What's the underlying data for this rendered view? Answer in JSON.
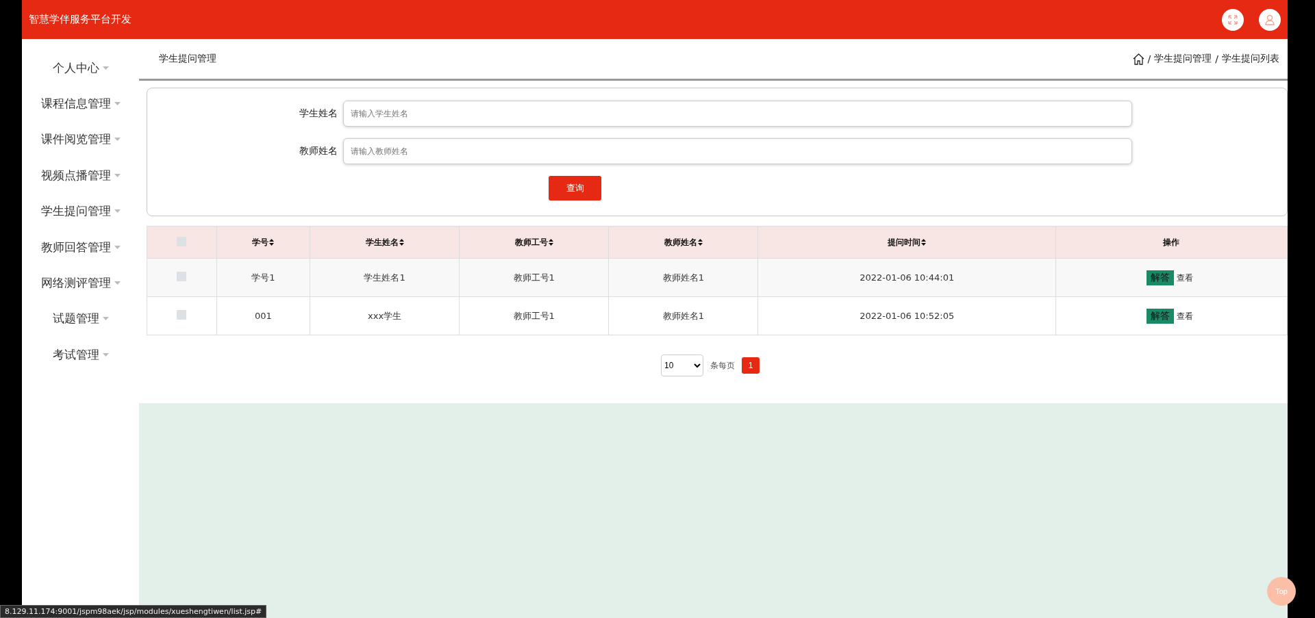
{
  "header": {
    "title": "智慧学伴服务平台开发"
  },
  "sidebar": {
    "items": [
      {
        "label": "个人中心"
      },
      {
        "label": "课程信息管理"
      },
      {
        "label": "课件阅览管理"
      },
      {
        "label": "视频点播管理"
      },
      {
        "label": "学生提问管理"
      },
      {
        "label": "教师回答管理"
      },
      {
        "label": "网络测评管理"
      },
      {
        "label": "试题管理"
      },
      {
        "label": "考试管理"
      }
    ]
  },
  "page": {
    "title": "学生提问管理",
    "breadcrumb": [
      {
        "separator": "/",
        "label": "学生提问管理"
      },
      {
        "separator": "/",
        "label": "学生提问列表"
      }
    ]
  },
  "search": {
    "fields": [
      {
        "label": "学生姓名",
        "placeholder": "请输入学生姓名"
      },
      {
        "label": "教师姓名",
        "placeholder": "请输入教师姓名"
      }
    ],
    "button": "查询"
  },
  "table": {
    "select_all_checked": false,
    "columns": [
      {
        "label": "学号",
        "sortable": true
      },
      {
        "label": "学生姓名",
        "sortable": true
      },
      {
        "label": "教师工号",
        "sortable": true
      },
      {
        "label": "教师姓名",
        "sortable": true
      },
      {
        "label": "提问时间",
        "sortable": true
      },
      {
        "label": "操作",
        "sortable": false
      }
    ],
    "rows": [
      {
        "checked": false,
        "cells": [
          "学号1",
          "学生姓名1",
          "教师工号1",
          "教师姓名1",
          "2022-01-06 10:44:01"
        ],
        "actions": [
          "解答",
          "查看"
        ]
      },
      {
        "checked": false,
        "cells": [
          "001",
          "xxx学生",
          "教师工号1",
          "教师姓名1",
          "2022-01-06 10:52:05"
        ],
        "actions": [
          "解答",
          "查看"
        ]
      }
    ]
  },
  "pagination": {
    "page_size": "10",
    "page_size_label": "条每页",
    "pages": [
      {
        "label": "1",
        "selected": true
      }
    ]
  },
  "status_url": "8.129.11.174:9001/jspm98aek/jsp/modules/xueshengtiwen/list.jsp#",
  "top_button": "Top"
}
